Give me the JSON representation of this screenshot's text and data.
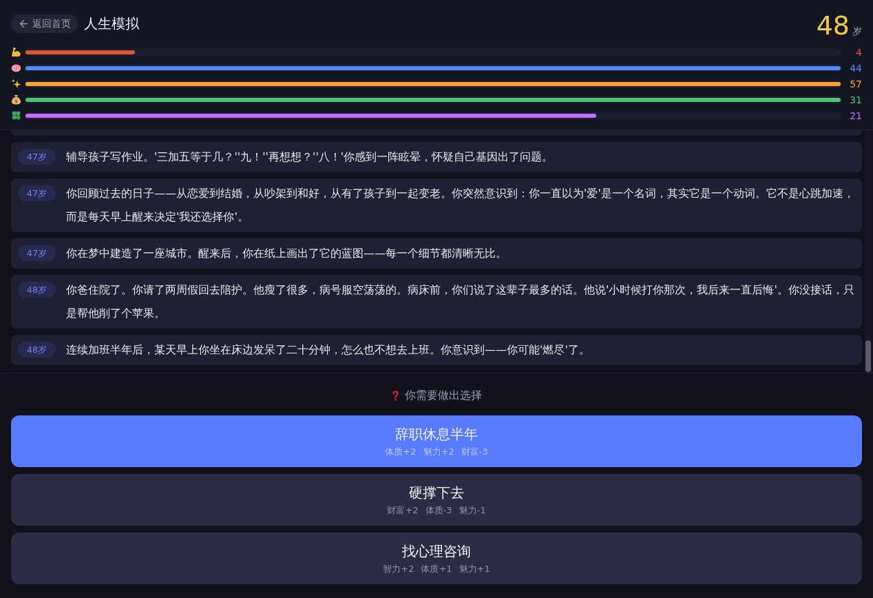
{
  "header": {
    "back_button": {
      "label": "返回首页"
    },
    "title": "人生模拟",
    "age": {
      "value": "48",
      "unit": "岁"
    }
  },
  "stats": [
    {
      "kind": "strength",
      "color": "#e0533f",
      "level": 0.134,
      "value": "4"
    },
    {
      "kind": "intelligence",
      "color": "#4f8bff",
      "level": 1,
      "value": "44"
    },
    {
      "kind": "charm",
      "color": "#ffa433",
      "level": 1,
      "value": "57"
    },
    {
      "kind": "wealth",
      "color": "#4cc46e",
      "level": 1,
      "value": "31"
    },
    {
      "kind": "luck",
      "color": "#c36ff5",
      "level": 0.7,
      "value": "21"
    }
  ],
  "log": [
    {
      "age": "47岁",
      "text": "辅导孩子写作业。'三加五等于几？''九！''再想想？''八！'你感到一阵眩晕，怀疑自己基因出了问题。"
    },
    {
      "age": "47岁",
      "text": "你回顾过去的日子——从恋爱到结婚，从吵架到和好，从有了孩子到一起变老。你突然意识到：你一直以为'爱'是一个名词，其实它是一个动词。它不是心跳加速，而是每天早上醒来决定'我还选择你'。"
    },
    {
      "age": "47岁",
      "text": "你在梦中建造了一座城市。醒来后，你在纸上画出了它的蓝图——每一个细节都清晰无比。"
    },
    {
      "age": "48岁",
      "text": "你爸住院了。你请了两周假回去陪护。他瘦了很多，病号服空荡荡的。病床前，你们说了这辈子最多的话。他说'小时候打你那次，我后来一直后悔'。你没接话，只是帮他削了个苹果。"
    },
    {
      "age": "48岁",
      "text": "连续加班半年后，某天早上你坐在床边发呆了二十分钟，怎么也不想去上班。你意识到——你可能'燃尽'了。"
    }
  ],
  "prompt": {
    "text": "你需要做出选择"
  },
  "choices": [
    {
      "title": "辞职休息半年",
      "effects": [
        "体质+2",
        "魅力+2",
        "财富-3"
      ],
      "selected": true
    },
    {
      "title": "硬撑下去",
      "effects": [
        "财富+2",
        "体质-3",
        "魅力-1"
      ],
      "selected": false
    },
    {
      "title": "找心理咨询",
      "effects": [
        "智力+2",
        "体质+1",
        "魅力+1"
      ],
      "selected": false
    }
  ]
}
